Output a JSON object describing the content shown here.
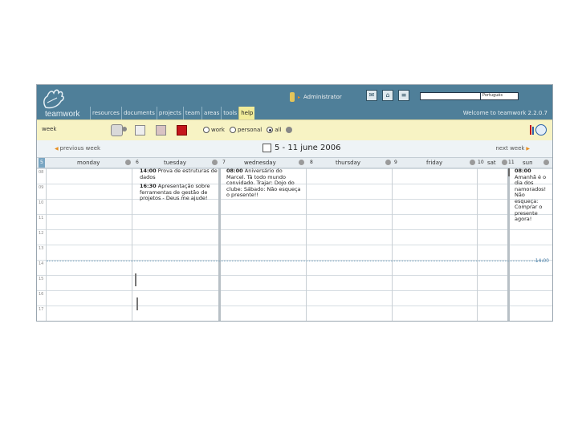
{
  "header": {
    "logo_text": "teamwork",
    "user": "Administrator",
    "search_placeholder": "",
    "language": "Português",
    "welcome": "Welcome to teamwork 2.2.0.7",
    "tabs": [
      {
        "label": "resources"
      },
      {
        "label": "documents"
      },
      {
        "label": "projects"
      },
      {
        "label": "team"
      },
      {
        "label": "areas"
      },
      {
        "label": "tools"
      },
      {
        "label": "help"
      }
    ]
  },
  "toolbar": {
    "view_label": "week",
    "filters": [
      {
        "label": "work",
        "selected": false
      },
      {
        "label": "personal",
        "selected": false
      },
      {
        "label": "all",
        "selected": true
      }
    ]
  },
  "weeknav": {
    "prev": "previous week",
    "next": "next week",
    "title": "5 - 11 june 2006"
  },
  "days": [
    {
      "num": "5",
      "name": "monday"
    },
    {
      "num": "6",
      "name": "tuesday"
    },
    {
      "num": "7",
      "name": "wednesday"
    },
    {
      "num": "8",
      "name": "thursday"
    },
    {
      "num": "9",
      "name": "friday"
    },
    {
      "num": "10",
      "name": "sat"
    },
    {
      "num": "11",
      "name": "sun"
    }
  ],
  "hours": [
    "08",
    "09",
    "10",
    "11",
    "12",
    "13",
    "14",
    "15",
    "16",
    "17"
  ],
  "now_label": "14:00",
  "events": {
    "tuesday_1_time": "14:00",
    "tuesday_1_text": "Prova de estruturas de dados",
    "tuesday_2_time": "16:30",
    "tuesday_2_text": "Apresentação sobre ferramentas de gestão de projetos - Deus me ajude!",
    "wednesday_1_time": "08:00",
    "wednesday_1_text": "Aniversário do Marcel. Tá todo mundo convidado. Trajar: Dojo do clube: Sábado: Não esqueça o presente!!",
    "sunday_1_time": "08:00",
    "sunday_1_text": "Amanhã é o dia dos namorados! Não esqueça: Comprar o presente agora!"
  },
  "colors": {
    "header_bg": "#4f7f99",
    "toolbar_bg": "#f7f3c4",
    "active_tab_bg": "#f1ec9a",
    "accent_arrow": "#e88f21"
  }
}
